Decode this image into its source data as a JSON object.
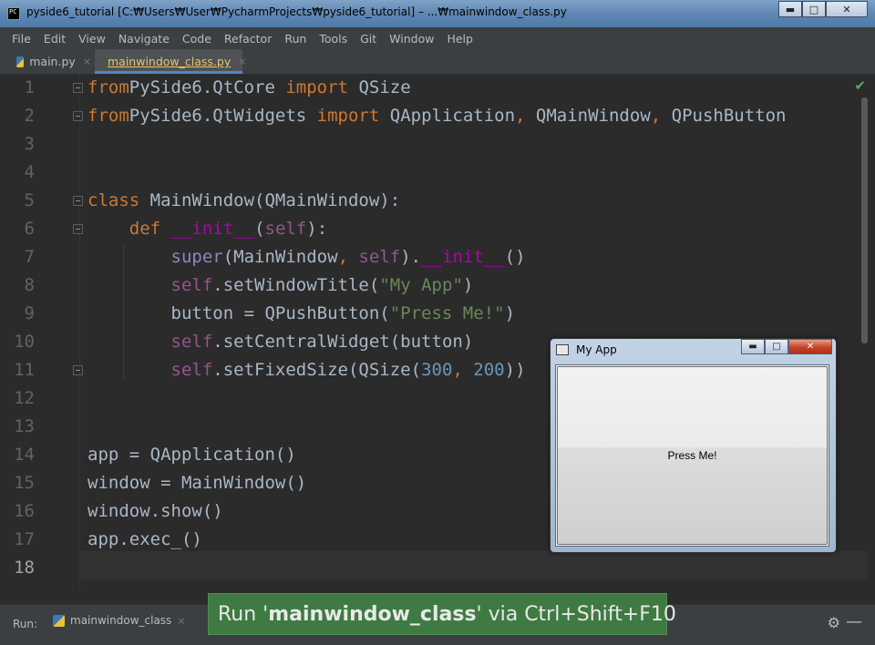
{
  "window": {
    "title": "pysidе6_tutorial  [C:₩Users₩User₩PycharmProjects₩pyside6_tutorial] – ...₩mainwindow_class.py",
    "minimize": "▬",
    "maximize": "□",
    "close": "✕"
  },
  "menu": [
    "File",
    "Edit",
    "View",
    "Navigate",
    "Code",
    "Refactor",
    "Run",
    "Tools",
    "Git",
    "Window",
    "Help"
  ],
  "tabs": [
    {
      "label": "main.py",
      "close": "×"
    },
    {
      "label": "mainwindow_class.py",
      "close": "×"
    }
  ],
  "editor": {
    "check": "✔",
    "line_numbers": [
      "1",
      "2",
      "3",
      "4",
      "5",
      "6",
      "7",
      "8",
      "9",
      "10",
      "11",
      "12",
      "13",
      "14",
      "15",
      "16",
      "17",
      "18"
    ],
    "current_line": "18"
  },
  "myapp": {
    "title": "My App",
    "button_label": "Press Me!",
    "min": "▬",
    "max": "□",
    "close": "✕"
  },
  "run": {
    "label": "Run:",
    "config": "mainwindow_class",
    "close": "×",
    "gear": "⚙",
    "hide": "—"
  },
  "hint": {
    "prefix": "Run '",
    "name": "mainwindow_class",
    "suffix": "' via Ctrl+Shift+F10"
  }
}
